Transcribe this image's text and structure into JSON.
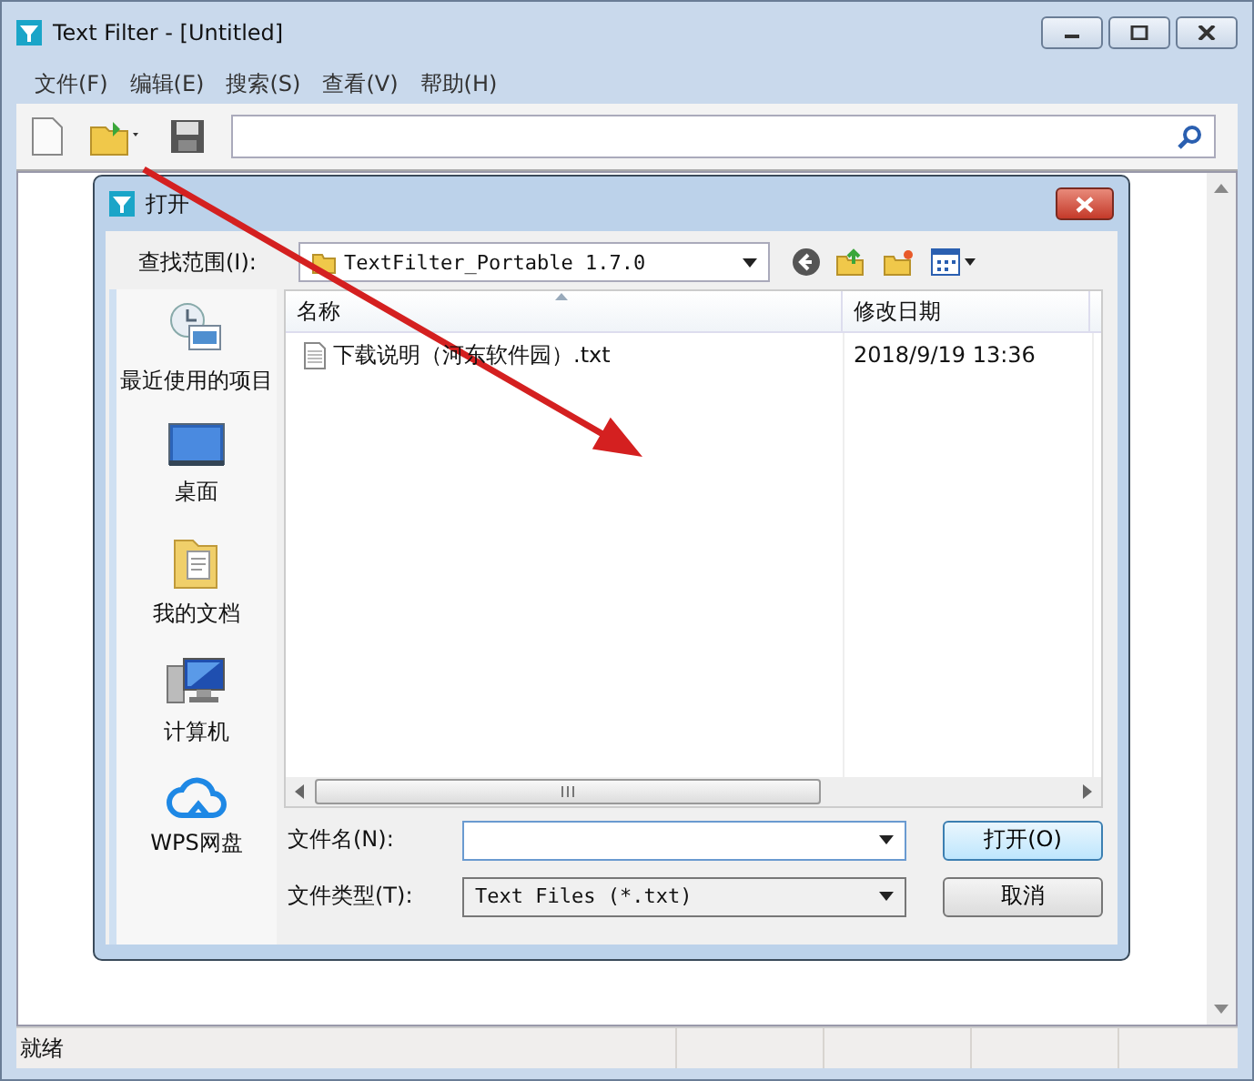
{
  "window": {
    "title": "Text Filter - [Untitled]"
  },
  "menu": [
    {
      "label": "文件(F)"
    },
    {
      "label": "编辑(E)"
    },
    {
      "label": "搜索(S)"
    },
    {
      "label": "查看(V)"
    },
    {
      "label": "帮助(H)"
    }
  ],
  "dialog": {
    "title": "打开",
    "look_in": {
      "label": "查找范围(I):",
      "value": "TextFilter_Portable 1.7.0"
    },
    "places": [
      {
        "label": "最近使用的项目",
        "kind": "recent"
      },
      {
        "label": "桌面",
        "kind": "desktop"
      },
      {
        "label": "我的文档",
        "kind": "documents"
      },
      {
        "label": "计算机",
        "kind": "computer"
      },
      {
        "label": "WPS网盘",
        "kind": "cloud"
      }
    ],
    "columns": [
      "名称",
      "修改日期"
    ],
    "files": [
      {
        "name": "下载说明（河东软件园）.txt",
        "modified": "2018/9/19 13:36"
      }
    ],
    "file_name": {
      "label": "文件名(N):"
    },
    "file_type": {
      "label": "文件类型(T):",
      "value": "Text Files (*.txt)"
    },
    "buttons": [
      {
        "label": "打开(O)",
        "default": true
      },
      {
        "label": "取消",
        "default": false
      }
    ]
  },
  "status_bar": {
    "text": "就绪"
  }
}
